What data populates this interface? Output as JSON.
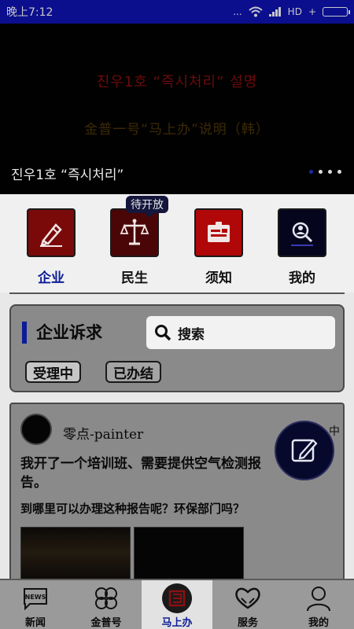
{
  "status_bar": {
    "time": "晚上7:12",
    "network": "HD",
    "dots": "..."
  },
  "banner": {
    "line1": "진우1호 “즉시처리” 설명",
    "line2": "金普一号“马上办”说明（韩）",
    "caption": "진우1호 “즉시처리”"
  },
  "categories": {
    "badge": "待开放",
    "items": [
      {
        "label": "企业",
        "icon": "pen-icon"
      },
      {
        "label": "民生",
        "icon": "scales-icon"
      },
      {
        "label": "须知",
        "icon": "id-card-icon"
      },
      {
        "label": "我的",
        "icon": "profile-search-icon"
      }
    ]
  },
  "appeal": {
    "title": "企业诉求",
    "search_label": "搜索",
    "chips": [
      "受理中",
      "已办结"
    ]
  },
  "post": {
    "author": "零点-painter",
    "more": "中",
    "title": "我开了一个培训班、需要提供空气检测报告。",
    "body": "到哪里可以办理这种报告呢？环保部门吗？"
  },
  "bottom_nav": [
    {
      "label": "新闻",
      "icon": "news-icon"
    },
    {
      "label": "金普号",
      "icon": "clover-icon"
    },
    {
      "label": "马上办",
      "icon": "stamp-icon"
    },
    {
      "label": "服务",
      "icon": "heart-hands-icon"
    },
    {
      "label": "我的",
      "icon": "person-icon"
    }
  ],
  "colors": {
    "accent": "#0c1d97",
    "status_bar": "#0b0f8e",
    "icon_red": "#8a0c0c"
  }
}
